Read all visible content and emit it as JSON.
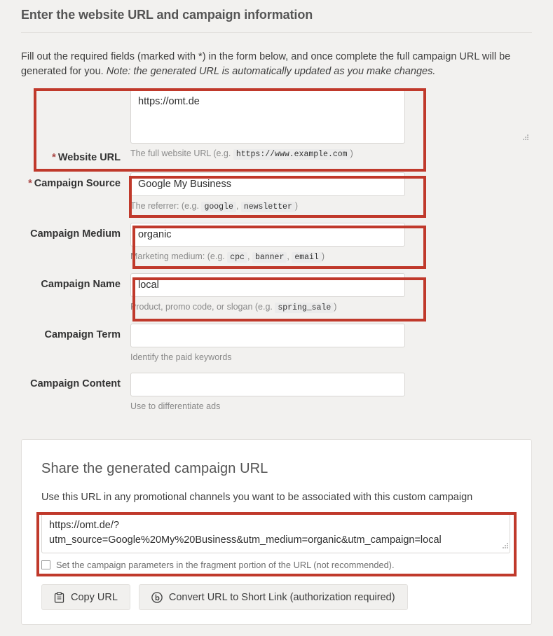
{
  "header": {
    "title": "Enter the website URL and campaign information"
  },
  "intro": {
    "text": "Fill out the required fields (marked with *) in the form below, and once complete the full campaign URL will be generated for you. ",
    "note": "Note: the generated URL is automatically updated as you make changes."
  },
  "form": {
    "website_url": {
      "label": "Website URL",
      "required_marker": "*",
      "value": "https://omt.de",
      "placeholder": "",
      "help_prefix": "The full website URL (e.g. ",
      "help_codes": [
        "https://www.example.com"
      ],
      "help_suffix": ")"
    },
    "campaign_source": {
      "label": "Campaign Source",
      "required_marker": "*",
      "value": "Google My Business",
      "placeholder": "",
      "help_prefix": "The referrer: (e.g. ",
      "help_codes": [
        "google",
        "newsletter"
      ],
      "help_suffix": ")"
    },
    "campaign_medium": {
      "label": "Campaign Medium",
      "required_marker": "",
      "value": "organic",
      "placeholder": "",
      "help_prefix": "Marketing medium: (e.g. ",
      "help_codes": [
        "cpc",
        "banner",
        "email"
      ],
      "help_suffix": ")"
    },
    "campaign_name": {
      "label": "Campaign Name",
      "required_marker": "",
      "value": "local",
      "placeholder": "",
      "help_prefix": "Product, promo code, or slogan (e.g. ",
      "help_codes": [
        "spring_sale"
      ],
      "help_suffix": ")"
    },
    "campaign_term": {
      "label": "Campaign Term",
      "required_marker": "",
      "value": "",
      "placeholder": "",
      "help_prefix": "Identify the paid keywords",
      "help_codes": [],
      "help_suffix": ""
    },
    "campaign_content": {
      "label": "Campaign Content",
      "required_marker": "",
      "value": "",
      "placeholder": "",
      "help_prefix": "Use to differentiate ads",
      "help_codes": [],
      "help_suffix": ""
    },
    "comma_separator": ","
  },
  "share": {
    "title": "Share the generated campaign URL",
    "subtitle": "Use this URL in any promotional channels you want to be associated with this custom campaign",
    "generated_url": "https://omt.de/?utm_source=Google%20My%20Business&utm_medium=organic&utm_campaign=local",
    "fragment_checkbox_label": "Set the campaign parameters in the fragment portion of the URL (not recommended).",
    "fragment_checkbox_checked": false,
    "copy_button_label": "Copy URL",
    "copy_button_icon": "clipboard-icon",
    "shorten_button_label": "Convert URL to Short Link (authorization required)",
    "shorten_button_icon": "bitly-icon"
  },
  "colors": {
    "highlight_red": "#c0392b",
    "page_background": "#f2f1ef",
    "card_background": "#ffffff",
    "required_asterisk": "#a94442"
  }
}
